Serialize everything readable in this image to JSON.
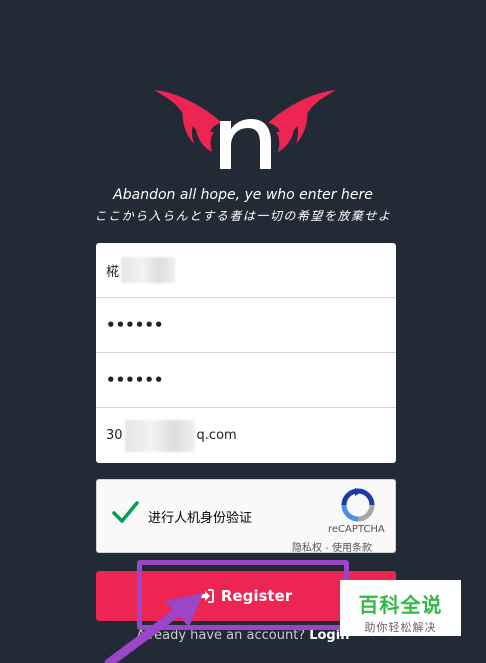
{
  "header": {
    "tagline_en": "Abandon all hope, ye who enter here",
    "tagline_jp": "ここから入らんとする者は一切の希望を放棄せよ"
  },
  "form": {
    "username_value": "椛",
    "password_value": "••••••",
    "confirm_password_value": "••••••",
    "email_prefix": "30",
    "email_suffix": "q.com"
  },
  "recaptcha": {
    "label": "进行人机身份验证",
    "brand": "reCAPTCHA",
    "links": "隐私权 - 使用条款",
    "checked": true
  },
  "register": {
    "label": "Register"
  },
  "login_prompt": {
    "text": "Already have an account?",
    "link": "Login"
  },
  "watermark": {
    "main": "百科全说",
    "sub": "助你轻松解决"
  },
  "colors": {
    "background": "#222a35",
    "accent": "#ed2553",
    "annotation": "#9b46c8",
    "check": "#00a050",
    "watermark_green": "#33b846"
  },
  "icons": {
    "logo": "bat-wing-n-logo",
    "check": "checkmark-icon",
    "recaptcha": "recaptcha-logo",
    "register": "sign-in-icon"
  }
}
